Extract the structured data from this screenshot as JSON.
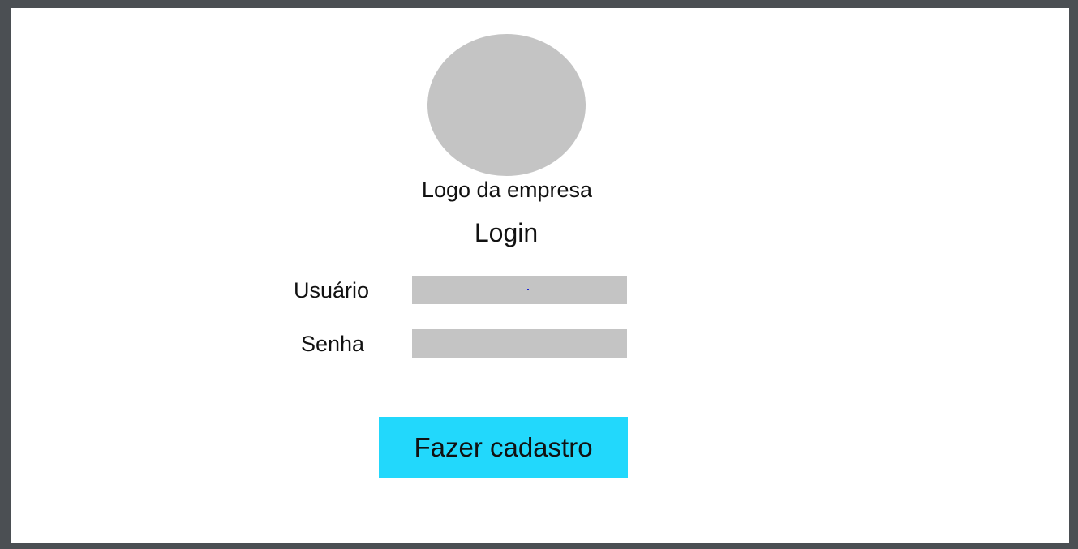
{
  "logo": {
    "caption": "Logo da empresa"
  },
  "form": {
    "title": "Login",
    "username": {
      "label": "Usuário",
      "value": ""
    },
    "password": {
      "label": "Senha",
      "value": ""
    }
  },
  "actions": {
    "signup_label": "Fazer cadastro"
  },
  "colors": {
    "frame": "#4b4f53",
    "canvas": "#ffffff",
    "placeholder_gray": "#c4c4c4",
    "button_accent": "#22d8fc"
  }
}
